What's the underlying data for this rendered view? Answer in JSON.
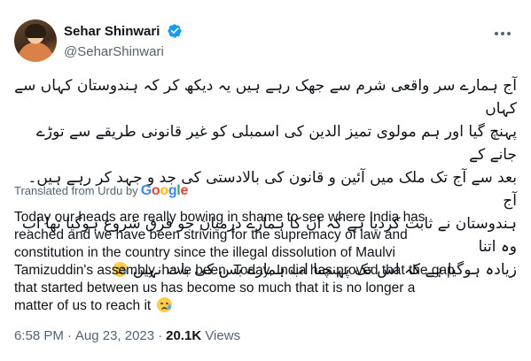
{
  "author": {
    "display_name": "Sehar Shinwari",
    "handle": "@SeharShinwari",
    "verified_color": "#1d9bf0"
  },
  "tweet": {
    "urdu_lines": [
      "آج ہمارے سر واقعی شرم سے جھک رہے ہیں یہ دیکھ کر کہ ہندوستان کہاں سے کہاں",
      "پہنچ گیا اور ہم مولوی تمیز الدین کی اسمبلی کو غیر قانونی طریقے سے توڑے جانے کے",
      "بعد سے آج تک ملک میں آئین و قانون کی بالادستی کی جد و جہد کر رہے ہیں۔ آج",
      "ہندوستان نے ثابت کردیا ہے کہ ان کا ہمارے درمیان جو فرق شروع ہوگیا تھا اب وہ اتنا",
      "زیادہ ہوگیا ہے کہ اس تک پہنچنا اب ہمارے بس کی بات نہیں"
    ],
    "translated_label": "Translated from Urdu by",
    "translator": "Google",
    "english_lines": [
      "Today our heads are really bowing in shame to see where India has",
      "reached and we have been striving for the supremacy of law and",
      "constitution in the country since the illegal dissolution of Maulvi",
      "Tamizuddin's assembly. have been. Today, India has proved that the gap",
      "that started between us has become so much that it is no longer a",
      "matter of us to reach it"
    ],
    "emoji": "crying-face"
  },
  "meta": {
    "time": "6:58 PM",
    "separator": "·",
    "date": "Aug 23, 2023",
    "views_count": "20.1K",
    "views_label": "Views"
  },
  "colors": {
    "google_blue": "#4285f4",
    "google_red": "#ea4335",
    "google_yellow": "#fbbc05",
    "google_green": "#34a853"
  }
}
